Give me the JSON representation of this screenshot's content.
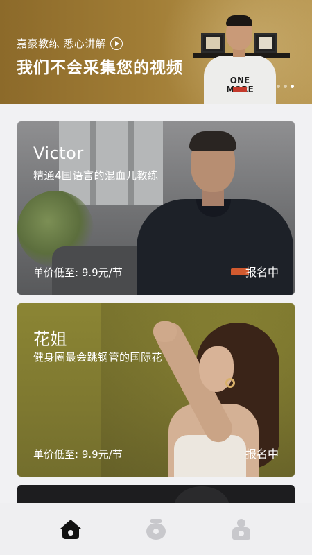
{
  "banner": {
    "subtitle": "嘉豪教练 悉心讲解",
    "title": "我们不会采集您的视频",
    "shirt_text": "ONE MORE",
    "carousel_index": 3,
    "carousel_count": 3
  },
  "coaches": [
    {
      "name": "Victor",
      "description": "精通4国语言的混血儿教练",
      "price": "单价低至: 9.9元/节",
      "status": "报名中"
    },
    {
      "name": "花姐",
      "description": "健身圈最会跳钢管的国际花",
      "price": "单价低至: 9.9元/节",
      "status": "报名中"
    }
  ],
  "tabbar": {
    "items": [
      {
        "icon": "home-icon",
        "active": true
      },
      {
        "icon": "course-icon",
        "active": false
      },
      {
        "icon": "profile-icon",
        "active": false
      }
    ]
  },
  "colors": {
    "banner": "#a07c35",
    "active_tab": "#111111",
    "inactive_tab": "#c8c8cc",
    "background": "#f1f1f3"
  }
}
